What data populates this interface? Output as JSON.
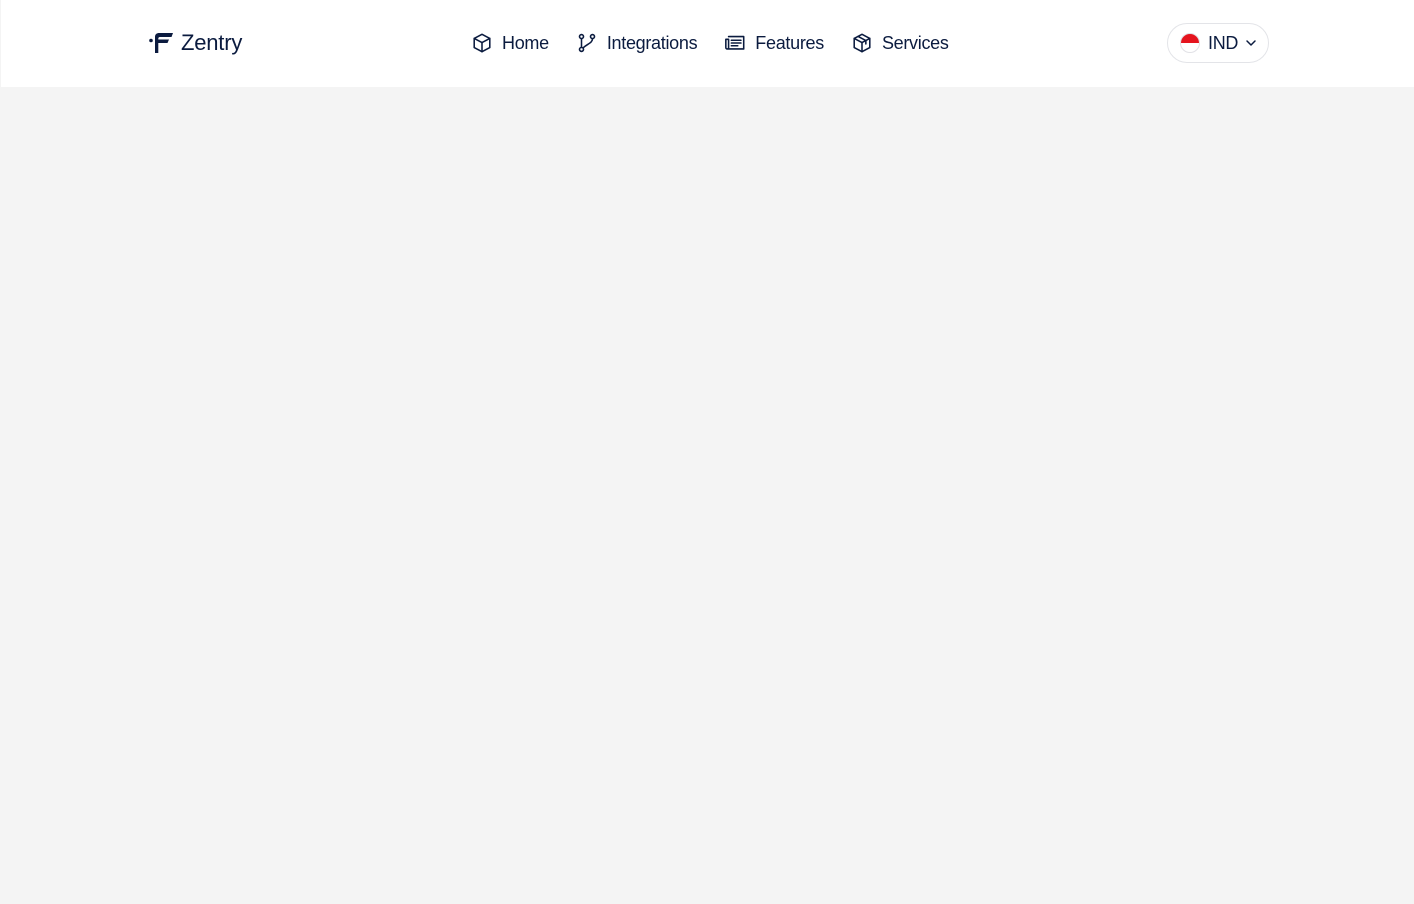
{
  "brand": {
    "name": "Zentry",
    "logo_icon": "brand-f-mark"
  },
  "nav": {
    "items": [
      {
        "label": "Home",
        "icon": "box-icon"
      },
      {
        "label": "Integrations",
        "icon": "git-branch-icon"
      },
      {
        "label": "Features",
        "icon": "newspaper-icon"
      },
      {
        "label": "Services",
        "icon": "package-icon"
      }
    ]
  },
  "locale": {
    "code": "IND",
    "flag": "indonesia-flag",
    "dropdown_icon": "chevron-down-icon"
  },
  "colors": {
    "text": "#0b1b3f",
    "header_bg": "#ffffff",
    "page_bg": "#f4f4f4",
    "flag_red": "#e5141e"
  }
}
